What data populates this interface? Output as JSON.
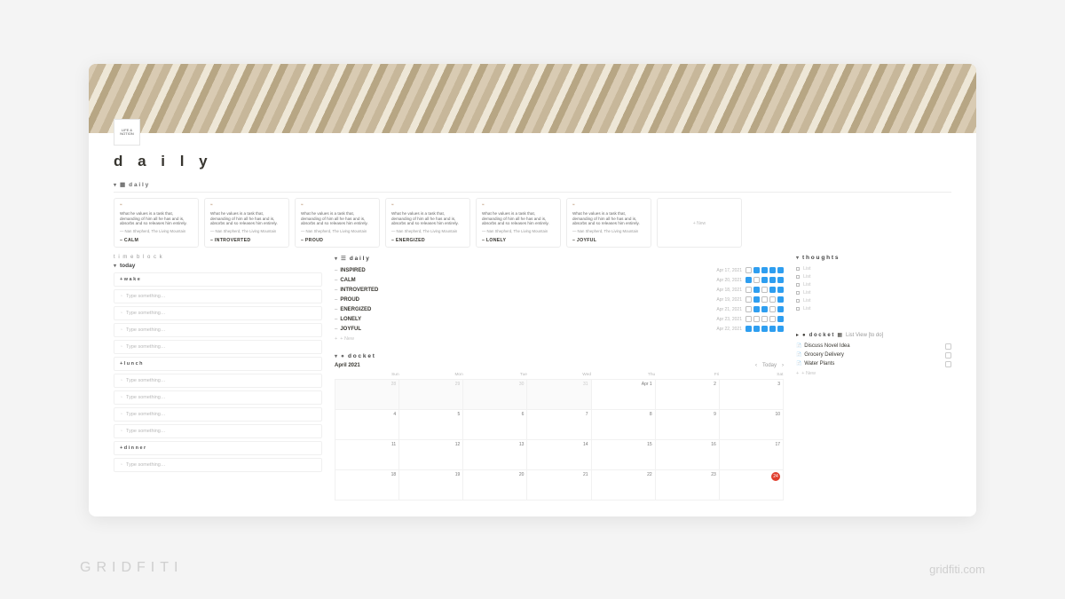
{
  "brand": {
    "left": "GRIDFITI",
    "right": "gridfiti.com"
  },
  "page": {
    "avatar_text": "LIFE & NOTION",
    "title": "d a i l y",
    "gallery_header": "d a i l y"
  },
  "quote": {
    "text": "What he values is a task that, demanding of him all he has and is, absorbs and so releases him entirely.",
    "attr": "— Nan Shepherd, The Living Mountain"
  },
  "moods": [
    "CALM",
    "INTROVERTED",
    "PROUD",
    "ENERGIZED",
    "LONELY",
    "JOYFUL"
  ],
  "gallery_new": "+ New",
  "timeblock": {
    "header": "t i m e b l o c k",
    "today": "today",
    "items": [
      {
        "type": "head",
        "label": "+ w a k e"
      },
      {
        "type": "slot",
        "label": "Type something…"
      },
      {
        "type": "slot",
        "label": "Type something…"
      },
      {
        "type": "slot",
        "label": "Type something…"
      },
      {
        "type": "slot",
        "label": "Type something…"
      },
      {
        "type": "head",
        "label": "+ l u n c h"
      },
      {
        "type": "slot",
        "label": "Type something…"
      },
      {
        "type": "slot",
        "label": "Type something…"
      },
      {
        "type": "slot",
        "label": "Type something…"
      },
      {
        "type": "slot",
        "label": "Type something…"
      },
      {
        "type": "head",
        "label": "+ d i n n e r"
      },
      {
        "type": "slot",
        "label": "Type something…"
      }
    ]
  },
  "daily_list": {
    "header": "d a i l y",
    "rows": [
      {
        "name": "INSPIRED",
        "date": "Apr 17, 2021",
        "checks": [
          false,
          true,
          true,
          true,
          true
        ]
      },
      {
        "name": "CALM",
        "date": "Apr 20, 2021",
        "checks": [
          true,
          false,
          true,
          true,
          true
        ]
      },
      {
        "name": "INTROVERTED",
        "date": "Apr 18, 2021",
        "checks": [
          false,
          true,
          false,
          true,
          true
        ]
      },
      {
        "name": "PROUD",
        "date": "Apr 19, 2021",
        "checks": [
          false,
          true,
          false,
          false,
          true
        ]
      },
      {
        "name": "ENERGIZED",
        "date": "Apr 21, 2021",
        "checks": [
          false,
          true,
          true,
          false,
          true
        ]
      },
      {
        "name": "LONELY",
        "date": "Apr 23, 2021",
        "checks": [
          false,
          false,
          false,
          false,
          true
        ]
      },
      {
        "name": "JOYFUL",
        "date": "Apr 22, 2021",
        "checks": [
          true,
          true,
          true,
          true,
          true
        ]
      }
    ],
    "new": "+ New"
  },
  "docket_cal": {
    "header": "d o c k e t",
    "month": "April 2021",
    "today": "Today",
    "dow": [
      "Sun",
      "Mon",
      "Tue",
      "Wed",
      "Thu",
      "Fri",
      "Sat"
    ],
    "weeks": [
      [
        {
          "n": "28",
          "o": true
        },
        {
          "n": "29",
          "o": true
        },
        {
          "n": "30",
          "o": true
        },
        {
          "n": "31",
          "o": true
        },
        {
          "n": "Apr 1"
        },
        {
          "n": "2"
        },
        {
          "n": "3"
        }
      ],
      [
        {
          "n": "4"
        },
        {
          "n": "5"
        },
        {
          "n": "6"
        },
        {
          "n": "7"
        },
        {
          "n": "8"
        },
        {
          "n": "9"
        },
        {
          "n": "10"
        }
      ],
      [
        {
          "n": "11"
        },
        {
          "n": "12"
        },
        {
          "n": "13"
        },
        {
          "n": "14"
        },
        {
          "n": "15"
        },
        {
          "n": "16"
        },
        {
          "n": "17"
        }
      ],
      [
        {
          "n": "18"
        },
        {
          "n": "19"
        },
        {
          "n": "20"
        },
        {
          "n": "21"
        },
        {
          "n": "22"
        },
        {
          "n": "23"
        },
        {
          "n": "24",
          "hl": true
        }
      ]
    ]
  },
  "thoughts": {
    "header": "t h o u g h t s",
    "items": [
      "List",
      "List",
      "List",
      "List",
      "List",
      "List"
    ]
  },
  "docket_list": {
    "header": "d o c k e t",
    "view": "List View [to do]",
    "items": [
      "Discuss Novel Idea",
      "Grocery Delivery",
      "Water Plants"
    ],
    "new": "+ New"
  }
}
